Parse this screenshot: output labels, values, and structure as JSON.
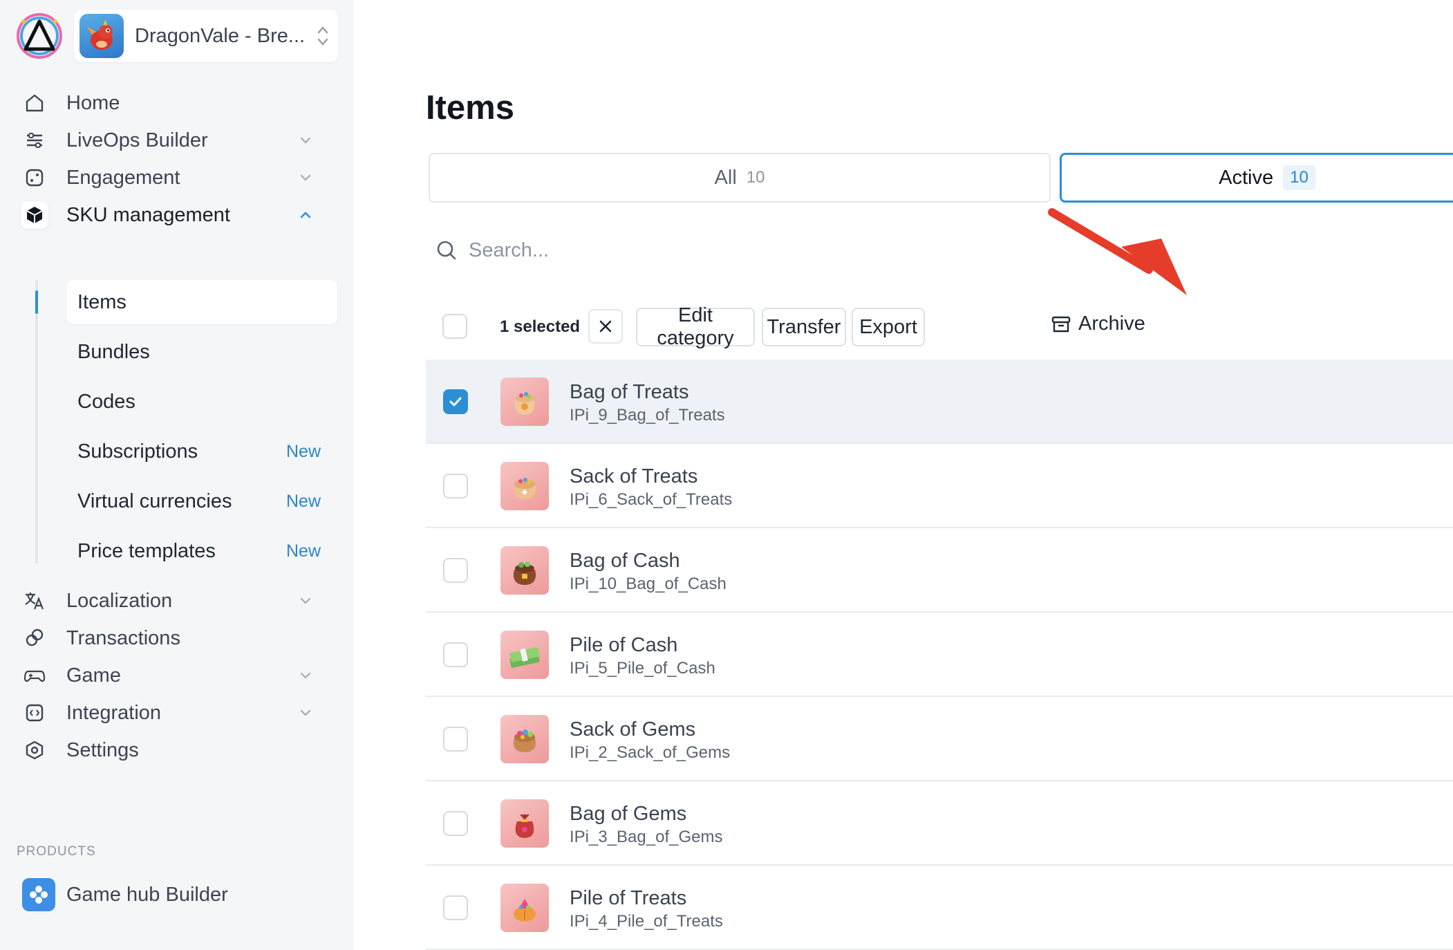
{
  "app": {
    "name": "DragonVale - Bre...",
    "colors": {
      "accent": "#2b8fd6",
      "arrow": "#e63c2a"
    }
  },
  "sidebar": {
    "nav": [
      {
        "label": "Home",
        "icon": "home-icon"
      },
      {
        "label": "LiveOps Builder",
        "icon": "sliders-icon"
      },
      {
        "label": "Engagement",
        "icon": "dice-icon"
      },
      {
        "label": "SKU management",
        "icon": "cube-icon"
      }
    ],
    "sku_sub": [
      {
        "label": "Items",
        "badge": ""
      },
      {
        "label": "Bundles",
        "badge": ""
      },
      {
        "label": "Codes",
        "badge": ""
      },
      {
        "label": "Subscriptions",
        "badge": "New"
      },
      {
        "label": "Virtual currencies",
        "badge": "New"
      },
      {
        "label": "Price templates",
        "badge": "New"
      }
    ],
    "nav2": [
      {
        "label": "Localization",
        "icon": "translate-icon"
      },
      {
        "label": "Transactions",
        "icon": "transactions-icon"
      },
      {
        "label": "Game",
        "icon": "gamepad-icon"
      },
      {
        "label": "Integration",
        "icon": "code-icon"
      },
      {
        "label": "Settings",
        "icon": "hexagon-gear-icon"
      }
    ],
    "products_label": "PRODUCTS",
    "products": [
      {
        "label": "Game hub Builder",
        "icon": "game-hub-icon"
      }
    ]
  },
  "main": {
    "title": "Items",
    "tabs": [
      {
        "label": "All",
        "count": "10"
      },
      {
        "label": "Active",
        "count": "10"
      }
    ],
    "search": {
      "placeholder": "Search..."
    },
    "toolbar": {
      "selected_text": "1 selected",
      "edit_category": "Edit category",
      "transfer": "Transfer",
      "export": "Export",
      "archive": "Archive"
    },
    "items": [
      {
        "name": "Bag of Treats",
        "sku": "IPi_9_Bag_of_Treats",
        "selected": true
      },
      {
        "name": "Sack of Treats",
        "sku": "IPi_6_Sack_of_Treats",
        "selected": false
      },
      {
        "name": "Bag of Cash",
        "sku": "IPi_10_Bag_of_Cash",
        "selected": false
      },
      {
        "name": "Pile of Cash",
        "sku": "IPi_5_Pile_of_Cash",
        "selected": false
      },
      {
        "name": "Sack of Gems",
        "sku": "IPi_2_Sack_of_Gems",
        "selected": false
      },
      {
        "name": "Bag of Gems",
        "sku": "IPi_3_Bag_of_Gems",
        "selected": false
      },
      {
        "name": "Pile of Treats",
        "sku": "IPi_4_Pile_of_Treats",
        "selected": false
      }
    ]
  }
}
